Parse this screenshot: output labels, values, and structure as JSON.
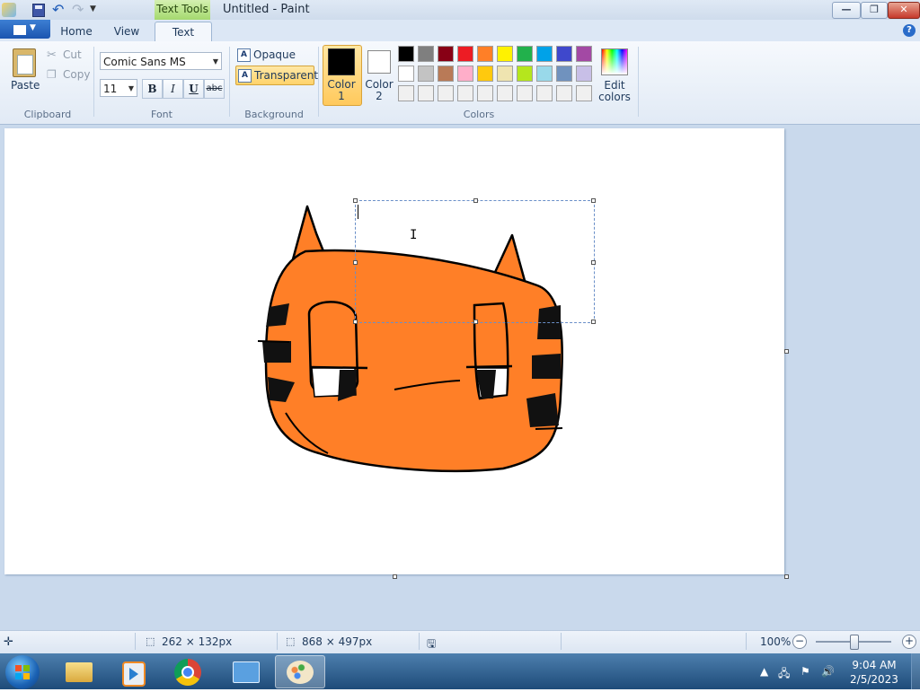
{
  "window": {
    "title": "Untitled - Paint",
    "context_tab": "Text Tools"
  },
  "tabs": [
    {
      "label": "Home"
    },
    {
      "label": "View"
    },
    {
      "label": "Text",
      "active": true
    }
  ],
  "clipboard": {
    "paste_label": "Paste",
    "cut_label": "Cut",
    "copy_label": "Copy",
    "group_label": "Clipboard"
  },
  "font": {
    "family": "Comic Sans MS",
    "size": "11",
    "group_label": "Font",
    "bold": "B",
    "italic": "I",
    "underline": "U",
    "strikethrough": "abc"
  },
  "background": {
    "opaque_label": "Opaque",
    "transparent_label": "Transparent",
    "selected": "Transparent",
    "group_label": "Background"
  },
  "colors": {
    "color1_label": "Color 1",
    "color2_label": "Color 2",
    "color1": "#000000",
    "color2": "#ffffff",
    "edit_label": "Edit colors",
    "group_label": "Colors",
    "palette_row1": [
      "#000000",
      "#7f7f7f",
      "#880015",
      "#ed1c24",
      "#ff7f27",
      "#fff200",
      "#22b14c",
      "#00a2e8",
      "#3f48cc",
      "#a349a4"
    ],
    "palette_row2": [
      "#ffffff",
      "#c3c3c3",
      "#b97a57",
      "#ffaec9",
      "#ffc90e",
      "#efe4b0",
      "#b5e61d",
      "#99d9ea",
      "#7092be",
      "#c8bfe7"
    ],
    "palette_row3": [
      "#f0f0f0",
      "#f0f0f0",
      "#f0f0f0",
      "#f0f0f0",
      "#f0f0f0",
      "#f0f0f0",
      "#f0f0f0",
      "#f0f0f0",
      "#f0f0f0",
      "#f0f0f0"
    ]
  },
  "status": {
    "selection_size": "262 × 132px",
    "canvas_size": "868 × 497px",
    "zoom": "100%"
  },
  "taskbar": {
    "time": "9:04 AM",
    "date": "2/5/2023"
  },
  "drawing": {
    "face_color": "#ff7f27",
    "outline_color": "#000000"
  }
}
